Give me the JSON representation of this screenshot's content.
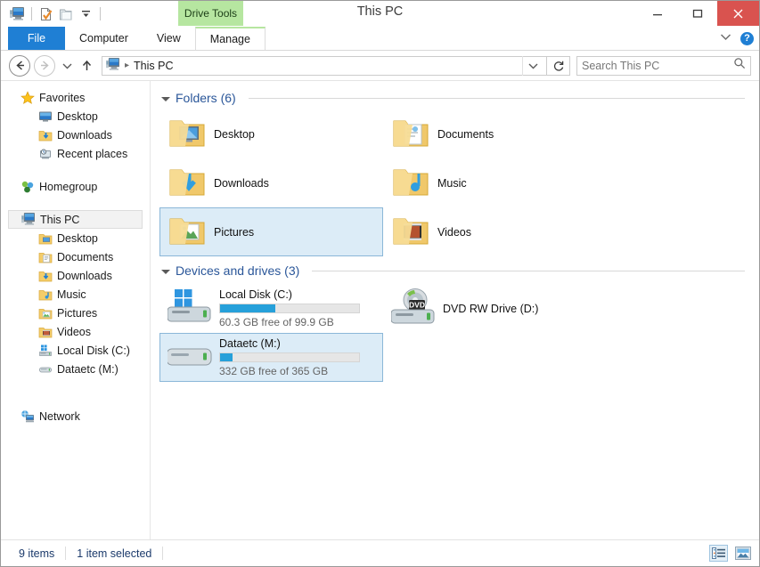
{
  "window": {
    "title": "This PC",
    "contextual_tab_header": "Drive Tools",
    "minimize_label": "–",
    "maximize_label": "❑",
    "close_label": "✕",
    "accent_blue": "#1f7fd4",
    "close_red": "#d9534f",
    "contextual_green": "#b6e6a0"
  },
  "quick_access": {
    "items": [
      {
        "name": "this-pc-icon",
        "label": "This PC"
      },
      {
        "name": "properties-icon",
        "label": "Properties"
      },
      {
        "name": "new-folder-icon",
        "label": "New folder"
      },
      {
        "name": "customize-dropdown-icon",
        "label": "Customize Quick Access Toolbar"
      }
    ]
  },
  "ribbon": {
    "tabs": [
      {
        "label": "File",
        "active": true
      },
      {
        "label": "Computer",
        "active": false
      },
      {
        "label": "View",
        "active": false
      },
      {
        "label": "Manage",
        "active": false
      }
    ],
    "expand_label": "⌄",
    "help_label": "?"
  },
  "address": {
    "back_label": "←",
    "forward_label": "→",
    "recent_label": "⌄",
    "up_label": "↑",
    "breadcrumb": "This PC",
    "crumb_separator": "▸",
    "path_dropdown_label": "⌄",
    "refresh_label": "↻",
    "search_placeholder": "Search This PC",
    "search_value": "",
    "search_icon_label": "⌕"
  },
  "navpane": {
    "groups": [
      {
        "header": {
          "label": "Favorites",
          "icon": "star-icon",
          "level": 0
        },
        "items": [
          {
            "label": "Desktop",
            "icon": "desktop-icon",
            "level": 1
          },
          {
            "label": "Downloads",
            "icon": "downloads-folder-icon",
            "level": 1
          },
          {
            "label": "Recent places",
            "icon": "recent-places-icon",
            "level": 1
          }
        ]
      },
      {
        "header": {
          "label": "Homegroup",
          "icon": "homegroup-icon",
          "level": 0
        },
        "items": []
      },
      {
        "header": {
          "label": "This PC",
          "icon": "this-pc-icon",
          "level": 0,
          "selected": true
        },
        "items": [
          {
            "label": "Desktop",
            "icon": "desktop-folder-icon",
            "level": 1
          },
          {
            "label": "Documents",
            "icon": "documents-folder-icon",
            "level": 1
          },
          {
            "label": "Downloads",
            "icon": "downloads-folder-icon",
            "level": 1
          },
          {
            "label": "Music",
            "icon": "music-folder-icon",
            "level": 1
          },
          {
            "label": "Pictures",
            "icon": "pictures-folder-icon",
            "level": 1
          },
          {
            "label": "Videos",
            "icon": "videos-folder-icon",
            "level": 1
          },
          {
            "label": "Local Disk (C:)",
            "icon": "local-disk-icon",
            "level": 1
          },
          {
            "label": "Dataetc (M:)",
            "icon": "hard-drive-icon",
            "level": 1
          }
        ]
      },
      {
        "header": {
          "label": "Network",
          "icon": "network-icon",
          "level": 0
        },
        "items": []
      }
    ]
  },
  "content": {
    "folders_section": {
      "title": "Folders (6)",
      "items": [
        {
          "label": "Desktop",
          "icon": "desktop-folder-icon",
          "selected": false
        },
        {
          "label": "Documents",
          "icon": "documents-folder-icon",
          "selected": false
        },
        {
          "label": "Downloads",
          "icon": "downloads-folder-icon",
          "selected": false
        },
        {
          "label": "Music",
          "icon": "music-folder-icon",
          "selected": false
        },
        {
          "label": "Pictures",
          "icon": "pictures-folder-icon",
          "selected": true
        },
        {
          "label": "Videos",
          "icon": "videos-folder-icon",
          "selected": false
        }
      ]
    },
    "drives_section": {
      "title": "Devices and drives (3)",
      "items": [
        {
          "label": "Local Disk (C:)",
          "icon": "windows-drive-icon",
          "free_text": "60.3 GB free of 99.9 GB",
          "used_percent": 40,
          "has_bar": true,
          "selected": false
        },
        {
          "label": "DVD RW Drive (D:)",
          "icon": "dvd-drive-icon",
          "free_text": "",
          "used_percent": 0,
          "has_bar": false,
          "selected": false
        },
        {
          "label": "Dataetc (M:)",
          "icon": "hard-drive-icon",
          "free_text": "332 GB free of 365 GB",
          "used_percent": 9,
          "has_bar": true,
          "selected": true
        }
      ]
    }
  },
  "statusbar": {
    "item_count": "9 items",
    "selection_text": "1 item selected",
    "views": [
      {
        "name": "details-view-button",
        "active": true
      },
      {
        "name": "large-icons-view-button",
        "active": false
      }
    ]
  }
}
